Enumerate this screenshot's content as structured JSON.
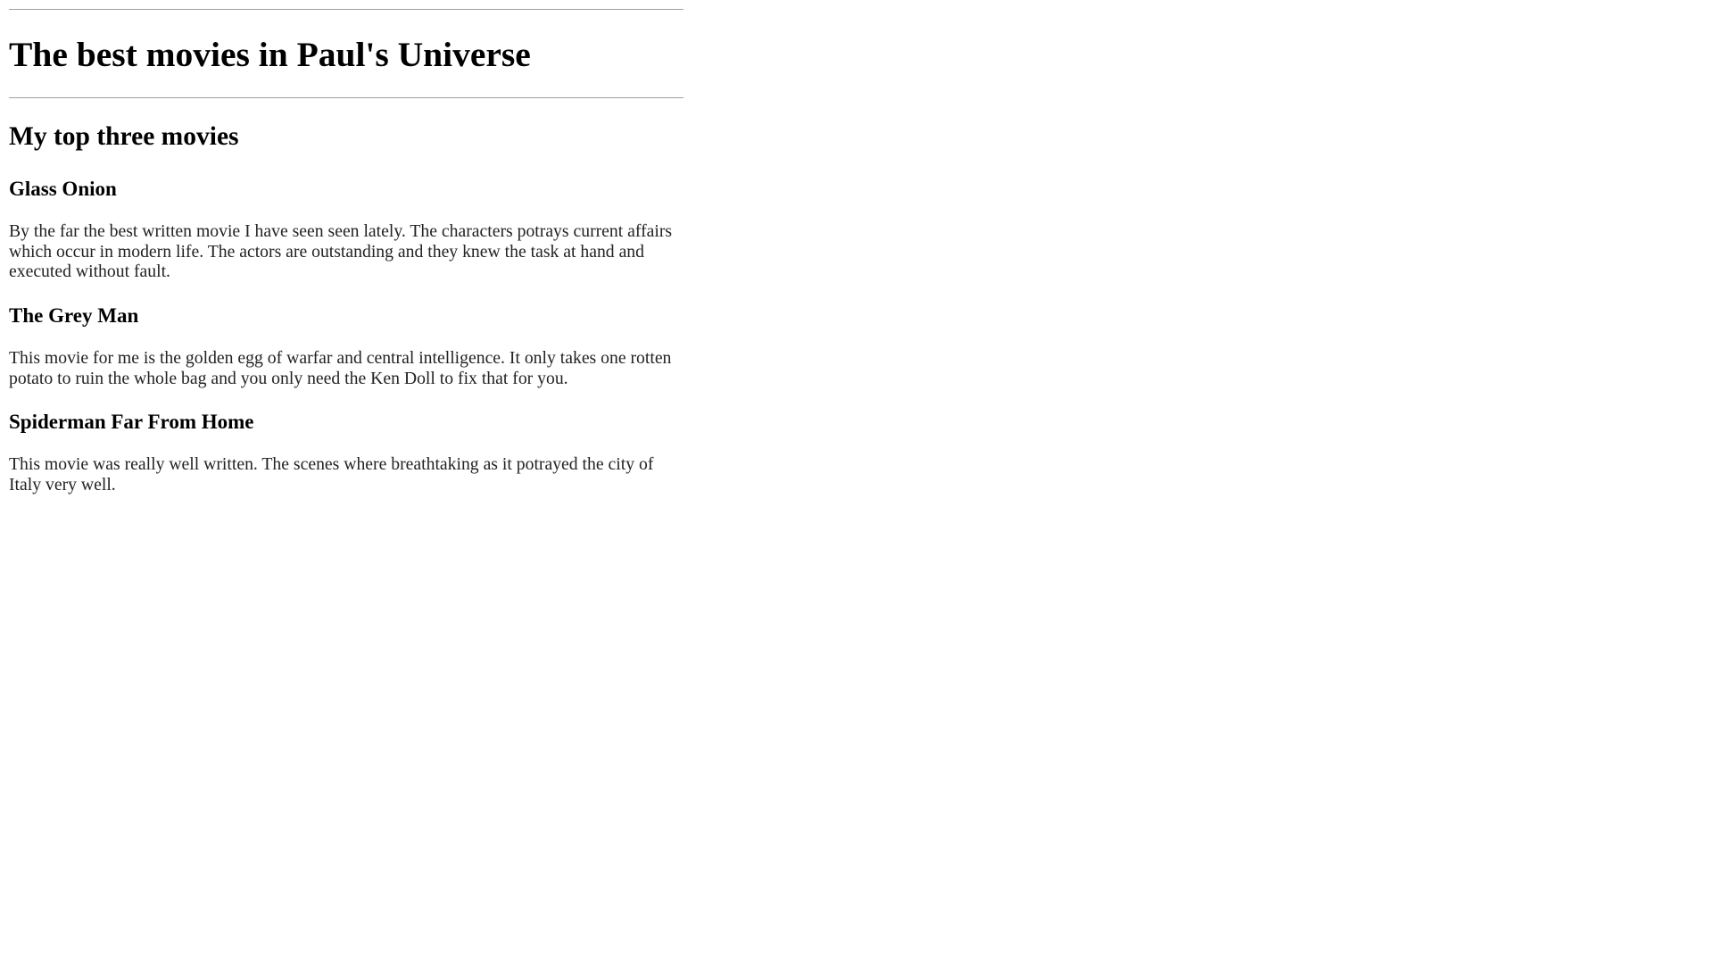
{
  "page": {
    "title": "The best movies in Paul's Universe",
    "section_heading": "My top three movies",
    "movies": [
      {
        "title": "Glass Onion",
        "review": "By the far the best written movie I have seen seen lately. The characters potrays current affairs which occur in modern life. The actors are outstanding and they knew the task at hand and executed without fault."
      },
      {
        "title": "The Grey Man",
        "review": "This movie for me is the golden egg of warfar and central intelligence. It only takes one rotten potato to ruin the whole bag and you only need the Ken Doll to fix that for you."
      },
      {
        "title": "Spiderman Far From Home",
        "review": "This movie was really well written. The scenes where breathtaking as it potrayed the city of Italy very well."
      }
    ]
  }
}
